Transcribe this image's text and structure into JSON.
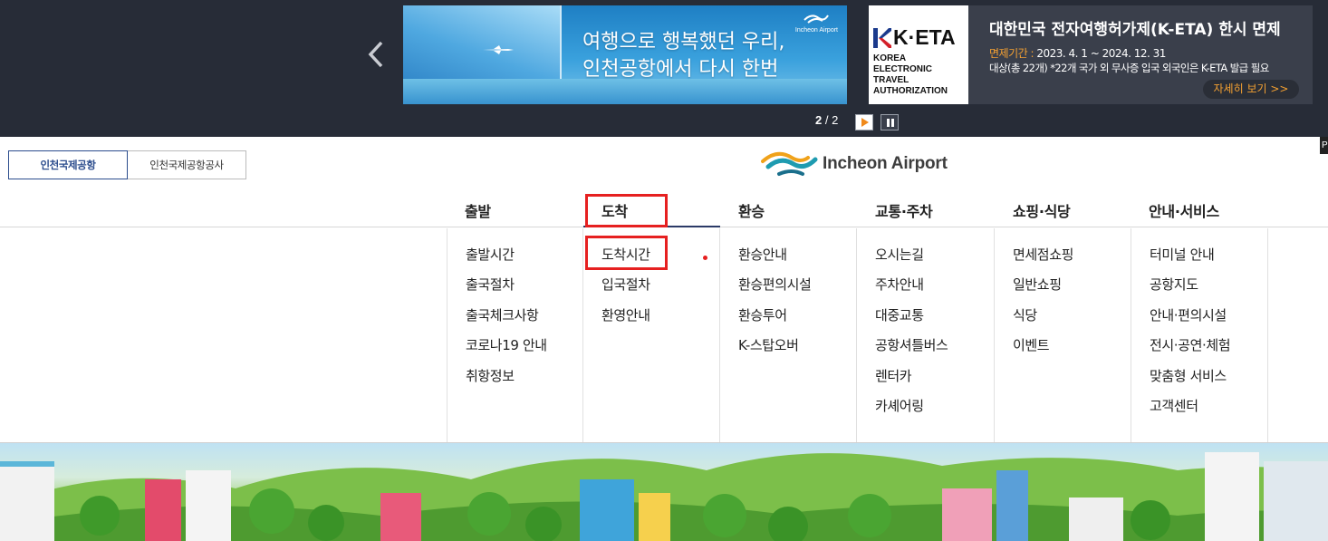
{
  "banner": {
    "promo_line1": "여행으로 행복했던 우리,",
    "promo_line2": "인천공항에서 다시 한번",
    "promo_logo_text": "Incheon Airport",
    "keta_mark": "K·ETA",
    "keta_sub": [
      "KOREA",
      "ELECTRONIC TRAVEL",
      "AUTHORIZATION"
    ],
    "keta_title": "대한민국 전자여행허가제(K-ETA) 한시 면제",
    "keta_period_label": "면제기간 : ",
    "keta_period": "2023. 4. 1 ~ 2024. 12. 31",
    "keta_desc": "대상(총 22개) *22개 국가 외 무사증 입국 외국인은 K-ETA 발급 필요",
    "keta_more": "자세히 보기 >>",
    "pager_current": "2",
    "pager_sep": " / ",
    "pager_total": "2",
    "edge_tab": "P"
  },
  "site_tabs": [
    {
      "label": "인천국제공항",
      "active": true
    },
    {
      "label": "인천국제공항공사",
      "active": false
    }
  ],
  "logo": {
    "text": "Incheon Airport"
  },
  "gnb": [
    {
      "label": "출발",
      "items": [
        "출발시간",
        "출국절차",
        "출국체크사항",
        "코로나19 안내",
        "취항정보"
      ]
    },
    {
      "label": "도착",
      "items": [
        "도착시간",
        "입국절차",
        "환영안내"
      ]
    },
    {
      "label": "환승",
      "items": [
        "환승안내",
        "환승편의시설",
        "환승투어",
        "K-스탑오버"
      ]
    },
    {
      "label": "교통·주차",
      "items": [
        "오시는길",
        "주차안내",
        "대중교통",
        "공항셔틀버스",
        "렌터카",
        "카셰어링"
      ]
    },
    {
      "label": "쇼핑·식당",
      "items": [
        "면세점쇼핑",
        "일반쇼핑",
        "식당",
        "이벤트"
      ]
    },
    {
      "label": "안내·서비스",
      "items": [
        "터미널 안내",
        "공항지도",
        "안내·편의시설",
        "전시·공연·체험",
        "맞춤형 서비스",
        "고객센터"
      ]
    }
  ],
  "colors": {
    "banner_bg": "#272c37",
    "accent_navy": "#2b4c8d",
    "highlight_red": "#e62020",
    "keta_orange": "#f3a032"
  }
}
